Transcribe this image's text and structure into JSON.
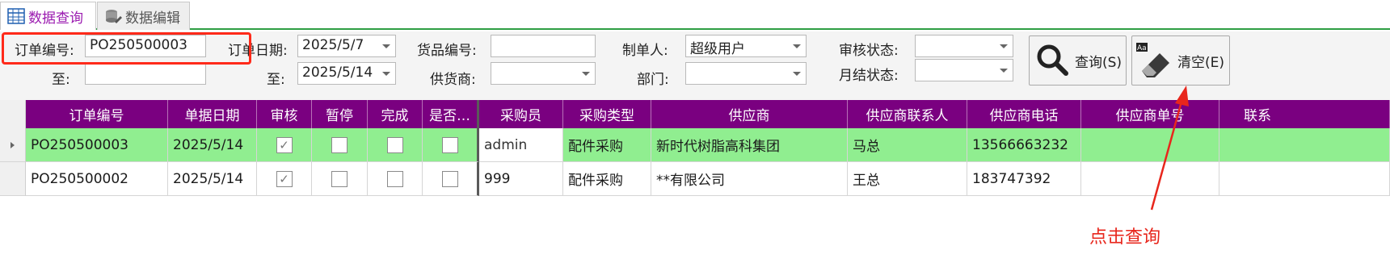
{
  "tabs": [
    {
      "label": "数据查询",
      "active": true
    },
    {
      "label": "数据编辑",
      "active": false
    }
  ],
  "filters": {
    "order_no_label": "订单编号:",
    "order_no_value": "PO250500003",
    "to_label_1": "至:",
    "to_value_1": "",
    "order_date_label": "订单日期:",
    "order_date_value": "2025/5/7",
    "to_label_2": "至:",
    "order_date_to": "2025/5/14",
    "goods_no_label": "货品编号:",
    "goods_no_value": "",
    "supplier_label": "供货商:",
    "supplier_value": "",
    "maker_label": "制单人:",
    "maker_value": "超级用户",
    "dept_label": "部门:",
    "dept_value": "",
    "audit_status_label": "审核状态:",
    "audit_status_value": "",
    "monthly_status_label": "月结状态:",
    "monthly_status_value": ""
  },
  "buttons": {
    "query_label": "查询(S)",
    "clear_label": "清空(E)"
  },
  "table": {
    "columns": [
      "订单编号",
      "单据日期",
      "审核",
      "暂停",
      "完成",
      "是否…",
      "采购员",
      "采购类型",
      "供应商",
      "供应商联系人",
      "供应商电话",
      "供应商单号",
      "联系"
    ],
    "rows": [
      {
        "order_no": "PO250500003",
        "date": "2025/5/14",
        "audited": true,
        "paused": false,
        "done": false,
        "whether": false,
        "buyer": "admin",
        "type": "配件采购",
        "supplier": "新时代树脂高科集团",
        "contact": "马总",
        "phone": "13566663232",
        "supplier_no": "",
        "selected": true
      },
      {
        "order_no": "PO250500002",
        "date": "2025/5/14",
        "audited": true,
        "paused": false,
        "done": false,
        "whether": false,
        "buyer": "999",
        "type": "配件采购",
        "supplier": "**有限公司",
        "contact": "王总",
        "phone": "183747392",
        "supplier_no": "",
        "selected": false
      }
    ]
  },
  "annotation": {
    "text": "点击查询"
  },
  "colors": {
    "header": "#7a0080",
    "selected_row": "#90ee90",
    "annotation": "#e8261c",
    "tab_active": "#9b1bb0"
  }
}
